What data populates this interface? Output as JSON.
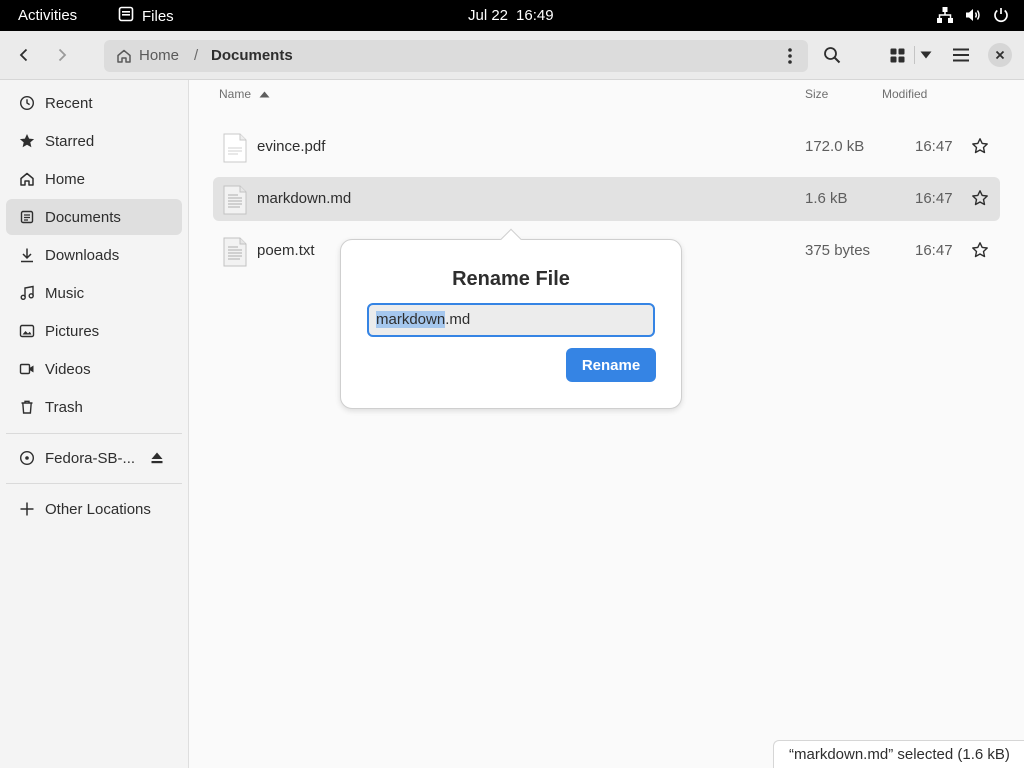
{
  "topbar": {
    "activities": "Activities",
    "app_name": "Files",
    "date": "Jul 22",
    "time": "16:49"
  },
  "header": {
    "home_label": "Home",
    "separator": "/",
    "current_folder": "Documents"
  },
  "sidebar": {
    "items": [
      {
        "label": "Recent",
        "icon": "clock-icon"
      },
      {
        "label": "Starred",
        "icon": "star-icon"
      },
      {
        "label": "Home",
        "icon": "home-icon"
      },
      {
        "label": "Documents",
        "icon": "document-icon"
      },
      {
        "label": "Downloads",
        "icon": "download-icon"
      },
      {
        "label": "Music",
        "icon": "music-icon"
      },
      {
        "label": "Pictures",
        "icon": "picture-icon"
      },
      {
        "label": "Videos",
        "icon": "video-icon"
      },
      {
        "label": "Trash",
        "icon": "trash-icon"
      }
    ],
    "device": {
      "label": "Fedora-SB-...",
      "icon": "disc-icon"
    },
    "other_locations": "Other Locations"
  },
  "columns": {
    "name": "Name",
    "size": "Size",
    "modified": "Modified"
  },
  "files": [
    {
      "name": "evince.pdf",
      "size": "172.0 kB",
      "modified": "16:47"
    },
    {
      "name": "markdown.md",
      "size": "1.6 kB",
      "modified": "16:47"
    },
    {
      "name": "poem.txt",
      "size": "375 bytes",
      "modified": "16:47"
    }
  ],
  "rename_dialog": {
    "title": "Rename File",
    "value_selected": "markdown",
    "value_rest": ".md",
    "button": "Rename"
  },
  "status": "“markdown.md” selected  (1.6 kB)",
  "colors": {
    "accent": "#3584e4",
    "topbar": "#000000",
    "selection": "#a5c7ee"
  }
}
